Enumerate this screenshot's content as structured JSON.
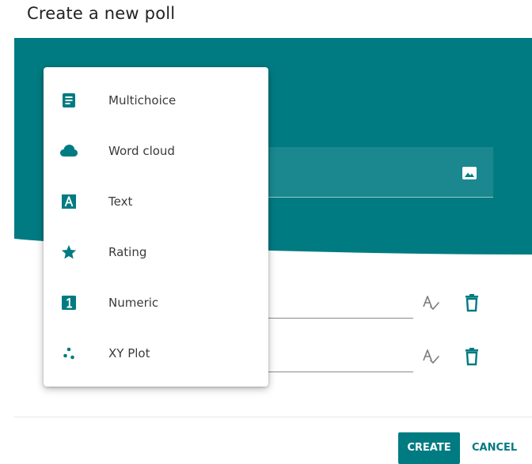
{
  "page": {
    "title": "Create a new poll"
  },
  "colors": {
    "brand_teal": "#007b82",
    "icon_gray": "#757575",
    "text_dark": "#3a3a3a"
  },
  "question": {
    "image_icon": "image-icon"
  },
  "options": [
    {
      "spellcheck_icon": "spellcheck-icon",
      "delete_icon": "trash-icon"
    },
    {
      "spellcheck_icon": "spellcheck-icon",
      "delete_icon": "trash-icon"
    }
  ],
  "menu": {
    "items": [
      {
        "label": "Multichoice",
        "icon": "multichoice-icon"
      },
      {
        "label": "Word cloud",
        "icon": "cloud-icon"
      },
      {
        "label": "Text",
        "icon": "text-a-icon"
      },
      {
        "label": "Rating",
        "icon": "star-icon"
      },
      {
        "label": "Numeric",
        "icon": "numeric-one-icon"
      },
      {
        "label": "XY Plot",
        "icon": "scatter-dots-icon"
      }
    ]
  },
  "footer": {
    "create_label": "CREATE",
    "cancel_label": "CANCEL"
  }
}
